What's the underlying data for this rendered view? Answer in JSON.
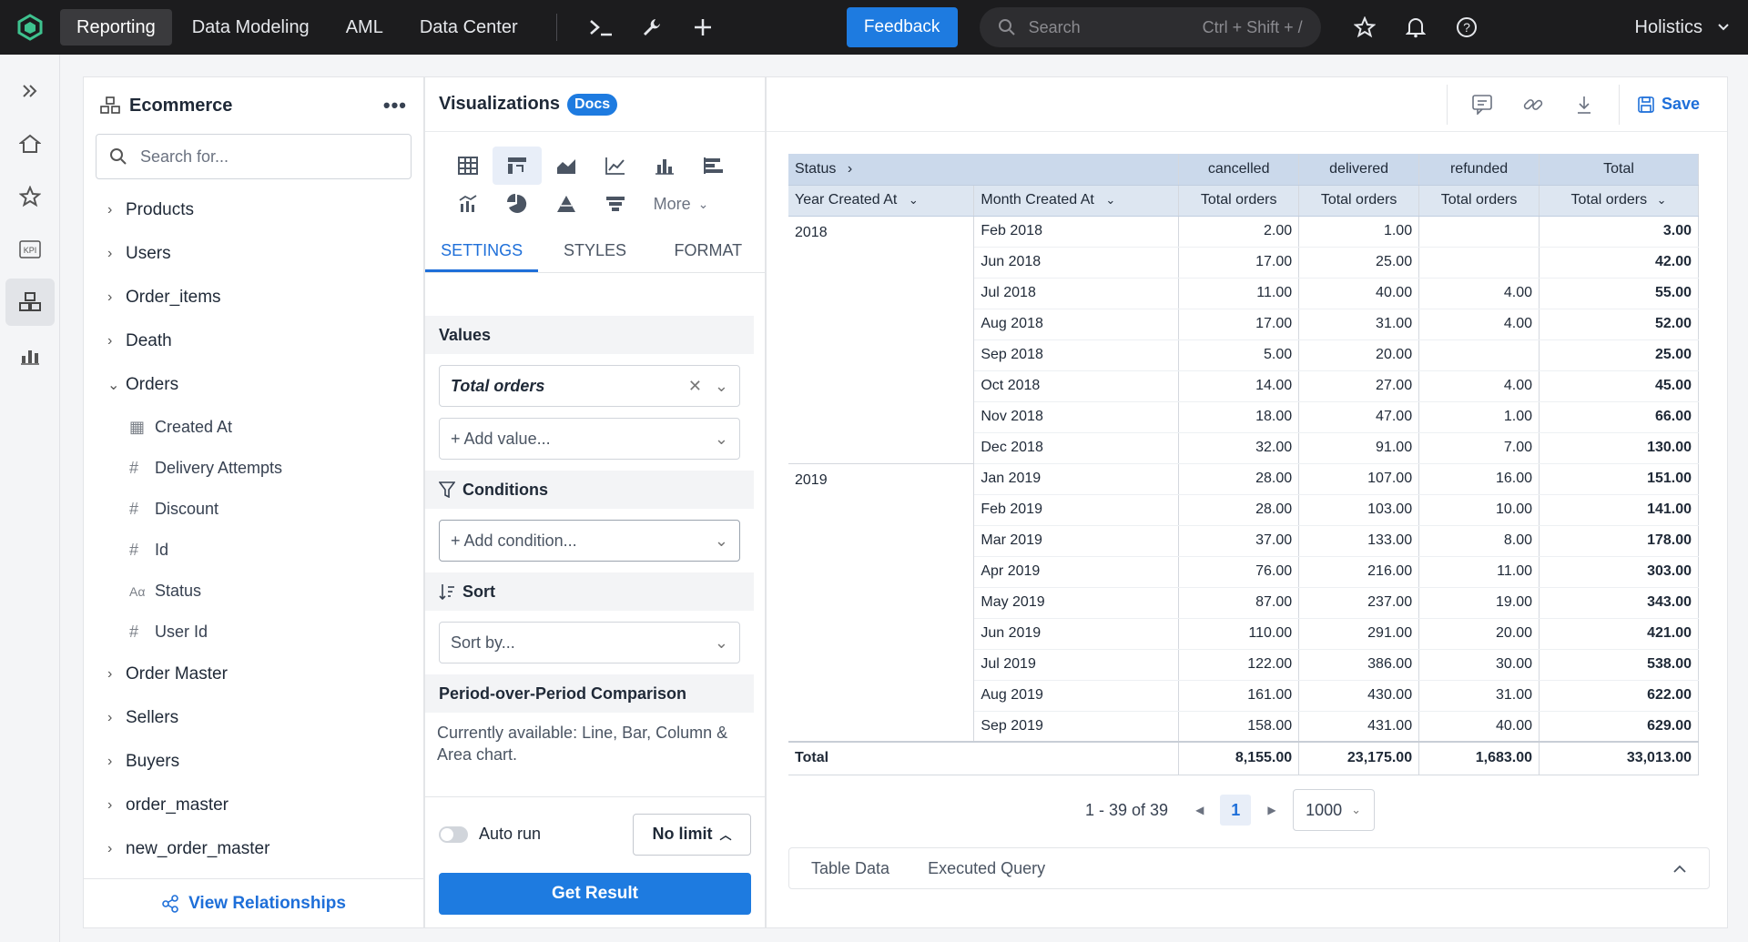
{
  "topnav": {
    "tabs": [
      {
        "label": "Reporting",
        "active": true
      },
      {
        "label": "Data Modeling"
      },
      {
        "label": "AML"
      },
      {
        "label": "Data Center"
      }
    ],
    "feedback": "Feedback",
    "search_placeholder": "Search",
    "search_shortcut": "Ctrl + Shift + /",
    "org": "Holistics"
  },
  "dataset": {
    "title": "Ecommerce",
    "search_placeholder": "Search for...",
    "models": [
      "Products",
      "Users",
      "Order_items",
      "Death"
    ],
    "open_model": "Orders",
    "fields": [
      {
        "icon": "date-icon",
        "name": "Created At"
      },
      {
        "icon": "number-icon",
        "name": "Delivery Attempts"
      },
      {
        "icon": "number-icon",
        "name": "Discount"
      },
      {
        "icon": "number-icon",
        "name": "Id"
      },
      {
        "icon": "text-icon",
        "name": "Status"
      },
      {
        "icon": "number-icon",
        "name": "User Id"
      }
    ],
    "more_models": [
      "Order Master",
      "Sellers",
      "Buyers",
      "order_master",
      "new_order_master"
    ],
    "view_relationships": "View Relationships"
  },
  "viz": {
    "title": "Visualizations",
    "docs": "Docs",
    "more": "More",
    "tabs": [
      "SETTINGS",
      "STYLES",
      "FORMAT"
    ],
    "values_label": "Values",
    "value_item": "Total orders",
    "add_value": "+ Add value...",
    "conditions_label": "Conditions",
    "add_condition": "+ Add condition...",
    "sort_label": "Sort",
    "sort_by": "Sort by...",
    "pop_label": "Period-over-Period Comparison",
    "pop_note": "Currently available: Line, Bar, Column & Area chart.",
    "auto_run": "Auto run",
    "limit": "No limit",
    "get_result": "Get Result"
  },
  "main": {
    "save": "Save"
  },
  "table": {
    "status_label": "Status",
    "year_label": "Year Created At",
    "month_label": "Month Created At",
    "statuses": [
      "cancelled",
      "delivered",
      "refunded",
      "Total"
    ],
    "measure": "Total orders",
    "groups": [
      {
        "year": "2018",
        "rows": [
          [
            "Feb 2018",
            "2.00",
            "1.00",
            "",
            "3.00"
          ],
          [
            "Jun 2018",
            "17.00",
            "25.00",
            "",
            "42.00"
          ],
          [
            "Jul 2018",
            "11.00",
            "40.00",
            "4.00",
            "55.00"
          ],
          [
            "Aug 2018",
            "17.00",
            "31.00",
            "4.00",
            "52.00"
          ],
          [
            "Sep 2018",
            "5.00",
            "20.00",
            "",
            "25.00"
          ],
          [
            "Oct 2018",
            "14.00",
            "27.00",
            "4.00",
            "45.00"
          ],
          [
            "Nov 2018",
            "18.00",
            "47.00",
            "1.00",
            "66.00"
          ],
          [
            "Dec 2018",
            "32.00",
            "91.00",
            "7.00",
            "130.00"
          ]
        ]
      },
      {
        "year": "2019",
        "rows": [
          [
            "Jan 2019",
            "28.00",
            "107.00",
            "16.00",
            "151.00"
          ],
          [
            "Feb 2019",
            "28.00",
            "103.00",
            "10.00",
            "141.00"
          ],
          [
            "Mar 2019",
            "37.00",
            "133.00",
            "8.00",
            "178.00"
          ],
          [
            "Apr 2019",
            "76.00",
            "216.00",
            "11.00",
            "303.00"
          ],
          [
            "May 2019",
            "87.00",
            "237.00",
            "19.00",
            "343.00"
          ],
          [
            "Jun 2019",
            "110.00",
            "291.00",
            "20.00",
            "421.00"
          ],
          [
            "Jul 2019",
            "122.00",
            "386.00",
            "30.00",
            "538.00"
          ],
          [
            "Aug 2019",
            "161.00",
            "430.00",
            "31.00",
            "622.00"
          ],
          [
            "Sep 2019",
            "158.00",
            "431.00",
            "40.00",
            "629.00"
          ]
        ]
      }
    ],
    "total": [
      "Total",
      "8,155.00",
      "23,175.00",
      "1,683.00",
      "33,013.00"
    ]
  },
  "pager": {
    "range": "1 - 39 of 39",
    "page": "1",
    "size": "1000"
  },
  "bottom_tabs": [
    "Table Data",
    "Executed Query"
  ]
}
